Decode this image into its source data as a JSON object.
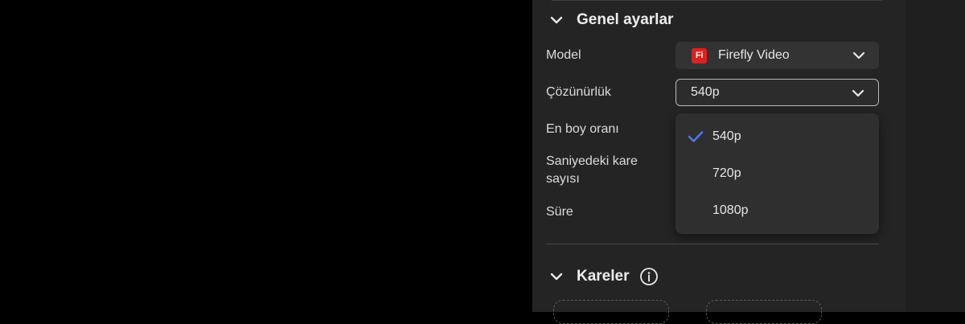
{
  "general_settings": {
    "title": "Genel ayarlar",
    "model_label": "Model",
    "model_value": "Firefly Video",
    "model_badge": "Fi",
    "resolution_label": "Çözünürlük",
    "resolution_value": "540p",
    "aspect_label": "En boy oranı",
    "fps_label": "Saniyedeki kare sayısı",
    "duration_label": "Süre"
  },
  "resolution_dropdown": {
    "options": [
      {
        "label": "540p",
        "selected": true
      },
      {
        "label": "720p",
        "selected": false
      },
      {
        "label": "1080p",
        "selected": false
      }
    ]
  },
  "frames": {
    "title": "Kareler"
  },
  "icons": {
    "section_toggle": "chevron-down-icon",
    "select_arrow": "chevron-down-icon",
    "selected_mark": "checkmark-icon",
    "info": "info-icon"
  },
  "colors": {
    "accent_check": "#4b7bf5",
    "firefly_badge": "#e01f1f",
    "panel_bg": "#242424"
  }
}
